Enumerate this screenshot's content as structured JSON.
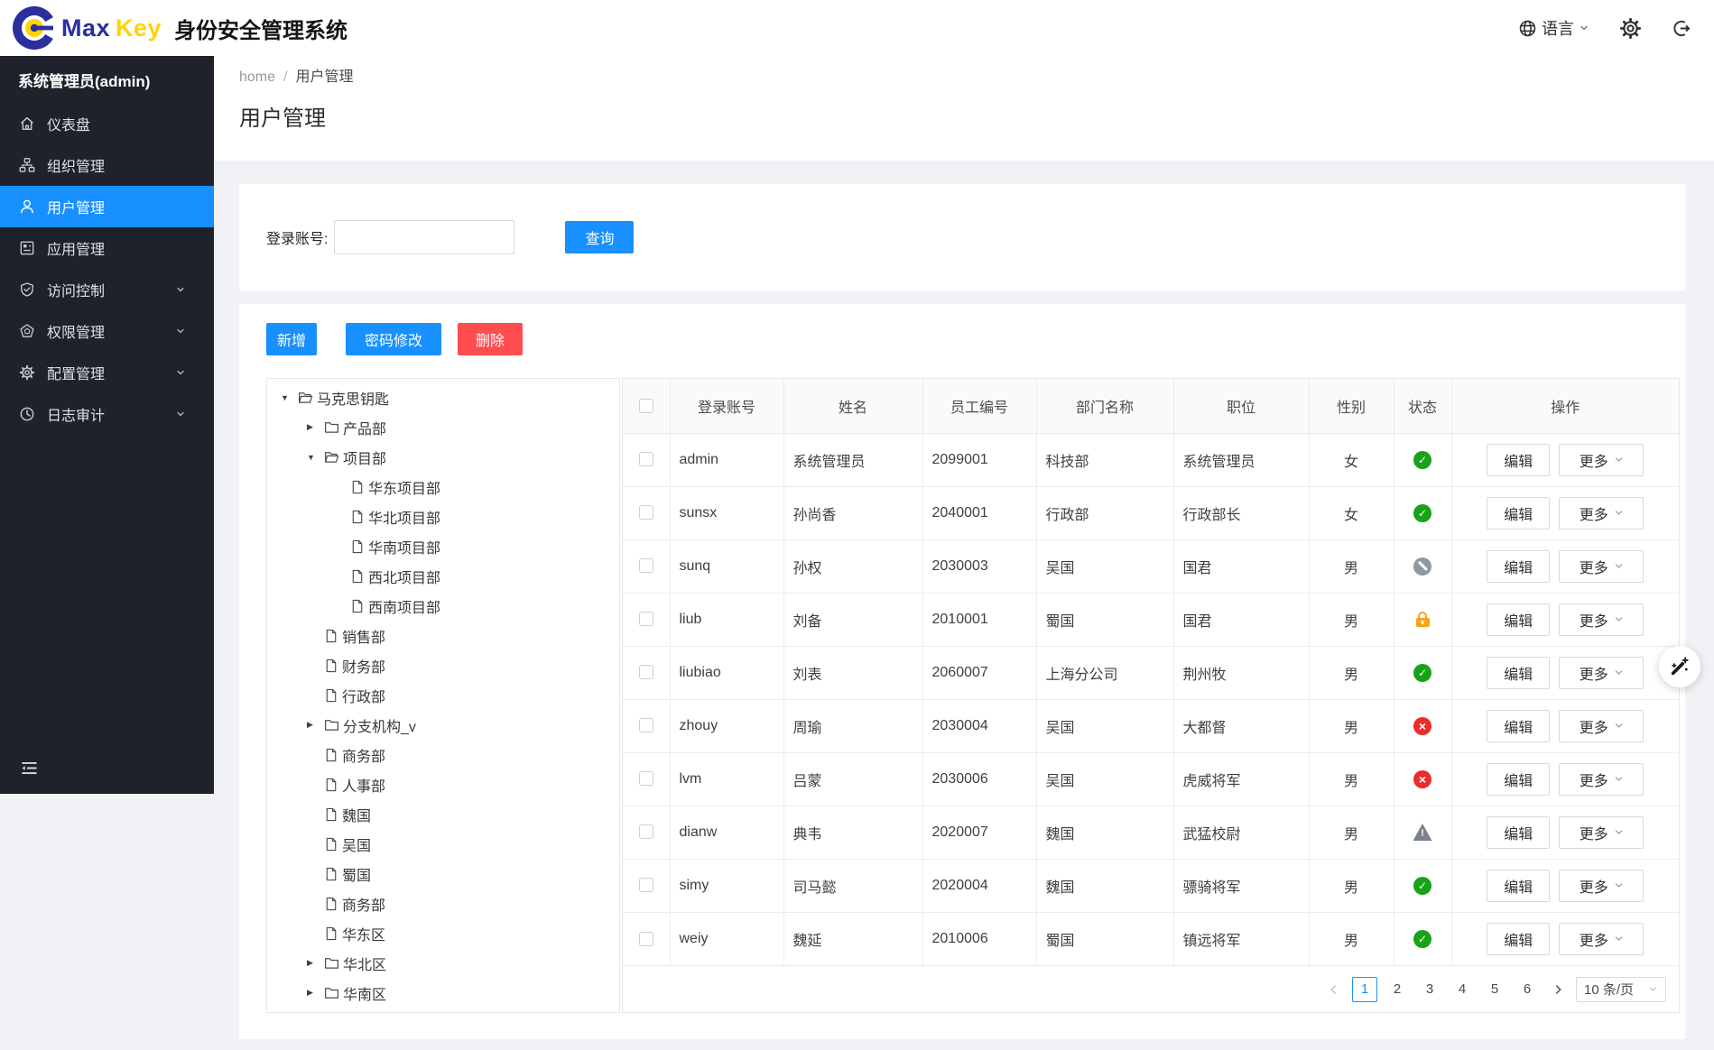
{
  "colors": {
    "accent": "#1890ff",
    "danger": "#ff4d4f",
    "navy": "#2b2f9e",
    "gold": "#ffd401"
  },
  "header": {
    "brand_max": "Max",
    "brand_key": "Key",
    "app_title": "身份安全管理系统",
    "language_label": "语言"
  },
  "sidebar": {
    "user_label": "系统管理员(admin)",
    "items": [
      {
        "key": "dashboard",
        "label": "仪表盘",
        "icon": "home",
        "active": false,
        "expandable": false
      },
      {
        "key": "organizations",
        "label": "组织管理",
        "icon": "org",
        "active": false,
        "expandable": false
      },
      {
        "key": "users",
        "label": "用户管理",
        "icon": "user",
        "active": true,
        "expandable": false
      },
      {
        "key": "applications",
        "label": "应用管理",
        "icon": "app",
        "active": false,
        "expandable": false
      },
      {
        "key": "access-control",
        "label": "访问控制",
        "icon": "shield",
        "active": false,
        "expandable": true
      },
      {
        "key": "permissions",
        "label": "权限管理",
        "icon": "pentagon",
        "active": false,
        "expandable": true
      },
      {
        "key": "configuration",
        "label": "配置管理",
        "icon": "gear",
        "active": false,
        "expandable": true
      },
      {
        "key": "audit-log",
        "label": "日志审计",
        "icon": "clock",
        "active": false,
        "expandable": true
      }
    ]
  },
  "breadcrumb": {
    "home": "home",
    "separator": "/",
    "current": "用户管理"
  },
  "page": {
    "title": "用户管理"
  },
  "search": {
    "label": "登录账号:",
    "value": "",
    "submit_label": "查询"
  },
  "toolbar": {
    "add_label": "新增",
    "change_password_label": "密码修改",
    "delete_label": "删除"
  },
  "tree": {
    "items": [
      {
        "label": "马克思钥匙",
        "level": 0,
        "icon": "folder-open",
        "caret": "down"
      },
      {
        "label": "产品部",
        "level": 1,
        "icon": "folder-closed",
        "caret": "right"
      },
      {
        "label": "项目部",
        "level": 1,
        "icon": "folder-open",
        "caret": "down"
      },
      {
        "label": "华东项目部",
        "level": 2,
        "icon": "file",
        "caret": "none"
      },
      {
        "label": "华北项目部",
        "level": 2,
        "icon": "file",
        "caret": "none"
      },
      {
        "label": "华南项目部",
        "level": 2,
        "icon": "file",
        "caret": "none"
      },
      {
        "label": "西北项目部",
        "level": 2,
        "icon": "file",
        "caret": "none"
      },
      {
        "label": "西南项目部",
        "level": 2,
        "icon": "file",
        "caret": "none"
      },
      {
        "label": "销售部",
        "level": 1,
        "icon": "file",
        "caret": "none"
      },
      {
        "label": "财务部",
        "level": 1,
        "icon": "file",
        "caret": "none"
      },
      {
        "label": "行政部",
        "level": 1,
        "icon": "file",
        "caret": "none"
      },
      {
        "label": "分支机构_v",
        "level": 1,
        "icon": "folder-closed",
        "caret": "right"
      },
      {
        "label": "商务部",
        "level": 1,
        "icon": "file",
        "caret": "none"
      },
      {
        "label": "人事部",
        "level": 1,
        "icon": "file",
        "caret": "none"
      },
      {
        "label": "魏国",
        "level": 1,
        "icon": "file",
        "caret": "none"
      },
      {
        "label": "吴国",
        "level": 1,
        "icon": "file",
        "caret": "none"
      },
      {
        "label": "蜀国",
        "level": 1,
        "icon": "file",
        "caret": "none"
      },
      {
        "label": "商务部",
        "level": 1,
        "icon": "file",
        "caret": "none"
      },
      {
        "label": "华东区",
        "level": 1,
        "icon": "file",
        "caret": "none"
      },
      {
        "label": "华北区",
        "level": 1,
        "icon": "folder-closed",
        "caret": "right"
      },
      {
        "label": "华南区",
        "level": 1,
        "icon": "folder-closed",
        "caret": "right"
      }
    ]
  },
  "table": {
    "columns": [
      "登录账号",
      "姓名",
      "员工编号",
      "部门名称",
      "职位",
      "性别",
      "状态",
      "操作"
    ],
    "edit_label": "编辑",
    "more_label": "更多",
    "rows": [
      {
        "login": "admin",
        "name": "系统管理员",
        "emp_no": "2099001",
        "dept": "科技部",
        "title": "系统管理员",
        "gender": "女",
        "status": "active"
      },
      {
        "login": "sunsx",
        "name": "孙尚香",
        "emp_no": "2040001",
        "dept": "行政部",
        "title": "行政部长",
        "gender": "女",
        "status": "active"
      },
      {
        "login": "sunq",
        "name": "孙权",
        "emp_no": "2030003",
        "dept": "吴国",
        "title": "国君",
        "gender": "男",
        "status": "disabled"
      },
      {
        "login": "liub",
        "name": "刘备",
        "emp_no": "2010001",
        "dept": "蜀国",
        "title": "国君",
        "gender": "男",
        "status": "locked"
      },
      {
        "login": "liubiao",
        "name": "刘表",
        "emp_no": "2060007",
        "dept": "上海分公司",
        "title": "荆州牧",
        "gender": "男",
        "status": "active"
      },
      {
        "login": "zhouy",
        "name": "周瑜",
        "emp_no": "2030004",
        "dept": "吴国",
        "title": "大都督",
        "gender": "男",
        "status": "rejected"
      },
      {
        "login": "lvm",
        "name": "吕蒙",
        "emp_no": "2030006",
        "dept": "吴国",
        "title": "虎威将军",
        "gender": "男",
        "status": "rejected"
      },
      {
        "login": "dianw",
        "name": "典韦",
        "emp_no": "2020007",
        "dept": "魏国",
        "title": "武猛校尉",
        "gender": "男",
        "status": "warning"
      },
      {
        "login": "simy",
        "name": "司马懿",
        "emp_no": "2020004",
        "dept": "魏国",
        "title": "骠骑将军",
        "gender": "男",
        "status": "active"
      },
      {
        "login": "weiy",
        "name": "魏延",
        "emp_no": "2010006",
        "dept": "蜀国",
        "title": "镇远将军",
        "gender": "男",
        "status": "active"
      }
    ]
  },
  "status_styles": {
    "active": {
      "shape": "circle-check",
      "color": "#17a318"
    },
    "disabled": {
      "shape": "circle-slash",
      "color": "#8f97a1"
    },
    "locked": {
      "shape": "lock",
      "color": "#f9a21a"
    },
    "rejected": {
      "shape": "circle-x",
      "color": "#ee2b2b"
    },
    "warning": {
      "shape": "triangle-exclamation",
      "color": "#79818c"
    }
  },
  "pagination": {
    "pages": [
      "1",
      "2",
      "3",
      "4",
      "5",
      "6"
    ],
    "current": "1",
    "page_size_label": "10 条/页"
  }
}
